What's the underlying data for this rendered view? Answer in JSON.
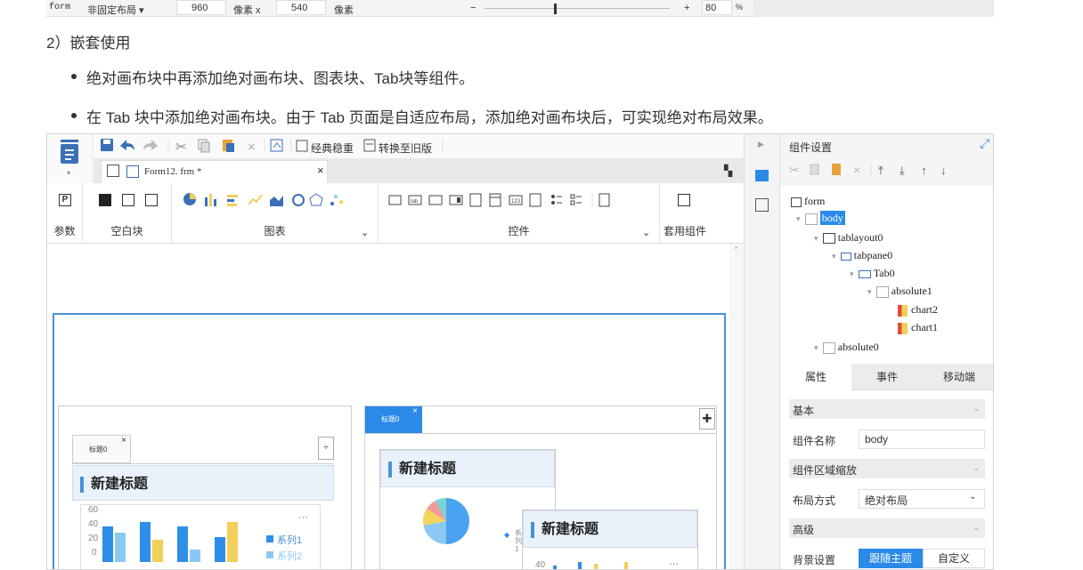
{
  "top_strip": {
    "form_label": "form",
    "layout_select": "非固定布局 ▾",
    "width_value": "960",
    "width_unit": "像素 x",
    "height_value": "540",
    "height_unit": "像素",
    "zoom_minus": "−",
    "zoom_plus": "+",
    "zoom_value": "80",
    "zoom_unit": "%"
  },
  "article": {
    "section_heading": "2）嵌套使用",
    "bullets": [
      "绝对画布块中再添加绝对画布块、图表块、Tab块等组件。",
      "在 Tab 块中添加绝对画布块。由于 Tab 页面是自适应布局，添加绝对画布块后，可实现绝对布局效果。"
    ]
  },
  "toolbar": {
    "classic_theme": "经典稳重",
    "convert_old": "转换至旧版"
  },
  "file_tab": {
    "name": "Form12. frm *",
    "close": "×"
  },
  "ribbon": {
    "groups": [
      {
        "label": "参数"
      },
      {
        "label": "空白块"
      },
      {
        "label": "图表"
      },
      {
        "label": "控件"
      },
      {
        "label": "套用组件"
      }
    ]
  },
  "canvas": {
    "tab_left": "标题0",
    "tab_right": "标题0",
    "tab_close": "×",
    "chart_title": "新建标题",
    "more": "···",
    "y_ticks": [
      "60",
      "40",
      "20",
      "0"
    ],
    "legend": [
      "系列1",
      "系列2"
    ],
    "bar_values_s1": [
      40,
      45,
      40,
      28
    ],
    "bar_values_s2": [
      33,
      25,
      14,
      45
    ],
    "pie_slices": [
      0.5,
      0.22,
      0.12,
      0.08,
      0.08
    ],
    "pie_colors": [
      "#4aa3f0",
      "#8cc8f4",
      "#f5d45a",
      "#f19a9a",
      "#7ed2d2"
    ],
    "mini_legend": "系 列1",
    "mini_tick": "40"
  },
  "panel": {
    "title": "组件设置",
    "tree": [
      {
        "label": "form",
        "level": 0
      },
      {
        "label": "body",
        "level": 1,
        "selected": true
      },
      {
        "label": "tablayout0",
        "level": 2
      },
      {
        "label": "tabpane0",
        "level": 3
      },
      {
        "label": "Tab0",
        "level": 4
      },
      {
        "label": "absolute1",
        "level": 5
      },
      {
        "label": "chart2",
        "level": 6
      },
      {
        "label": "chart1",
        "level": 6
      },
      {
        "label": "absolute0",
        "level": 2
      }
    ],
    "tabs": [
      "属性",
      "事件",
      "移动端"
    ],
    "sections": {
      "basic": "基本",
      "name_label": "组件名称",
      "name_value": "body",
      "scale_label": "组件区域缩放",
      "layout_label": "布局方式",
      "layout_value": "绝对布局",
      "advanced": "高级",
      "bg_label": "背景设置",
      "bg_follow": "跟随主题",
      "bg_custom": "自定义"
    }
  },
  "colors": {
    "accent": "#2b8ae8",
    "bar1": "#2f8ee6",
    "bar2": "#f3cf59",
    "bar3": "#8cc8f4"
  }
}
